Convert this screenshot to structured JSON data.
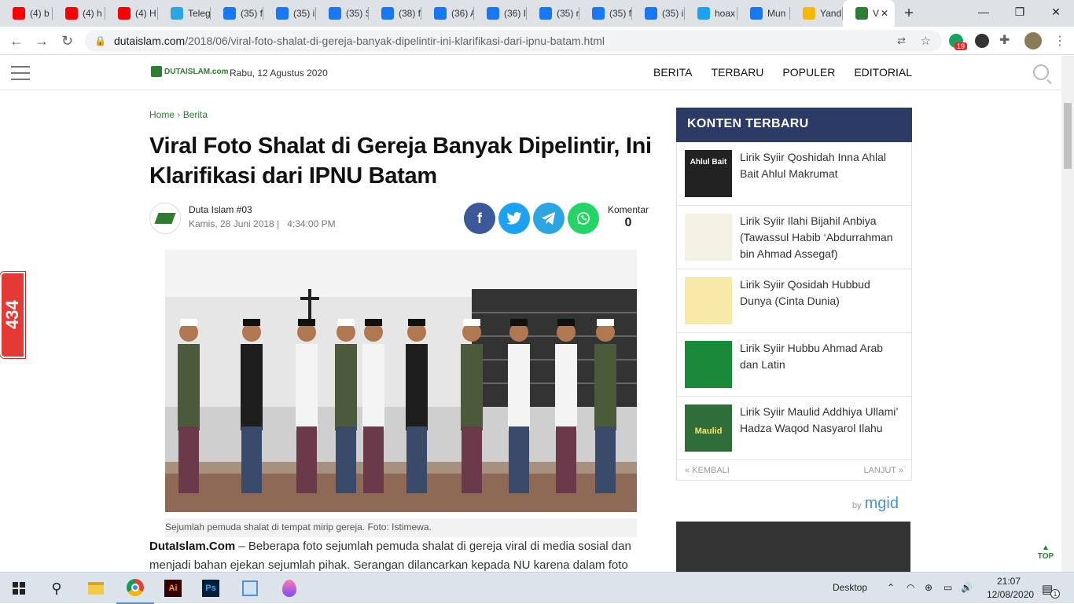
{
  "browser": {
    "tabs": [
      {
        "label": "(4) b",
        "icon": "youtube-icon",
        "color": "#ff0000"
      },
      {
        "label": "(4) h",
        "icon": "youtube-icon",
        "color": "#ff0000"
      },
      {
        "label": "(4) H",
        "icon": "youtube-icon",
        "color": "#ff0000"
      },
      {
        "label": "Teleg",
        "icon": "telegram-icon",
        "color": "#2ca5e0"
      },
      {
        "label": "(35) f",
        "icon": "facebook-icon",
        "color": "#1877f2"
      },
      {
        "label": "(35) i",
        "icon": "facebook-icon",
        "color": "#1877f2"
      },
      {
        "label": "(35) S",
        "icon": "facebook-icon",
        "color": "#1877f2"
      },
      {
        "label": "(38) f",
        "icon": "facebook-icon",
        "color": "#1877f2"
      },
      {
        "label": "(36) A",
        "icon": "facebook-icon",
        "color": "#1877f2"
      },
      {
        "label": "(36) I",
        "icon": "facebook-icon",
        "color": "#1877f2"
      },
      {
        "label": "(35) r",
        "icon": "facebook-icon",
        "color": "#1877f2"
      },
      {
        "label": "(35) f",
        "icon": "facebook-icon",
        "color": "#1877f2"
      },
      {
        "label": "(35) i",
        "icon": "facebook-icon",
        "color": "#1877f2"
      },
      {
        "label": "hoax",
        "icon": "twitter-icon",
        "color": "#1da1f2"
      },
      {
        "label": "Mun",
        "icon": "facebook-icon",
        "color": "#1877f2"
      },
      {
        "label": "Yand",
        "icon": "yandex-icon",
        "color": "#f5b700"
      },
      {
        "label": "V",
        "icon": "dutaislam-icon",
        "color": "#2e7d32",
        "active": true
      }
    ],
    "url_host": "dutaislam.com",
    "url_path": "/2018/06/viral-foto-shalat-di-gereja-banyak-dipelintir-ini-klarifikasi-dari-ipnu-batam.html",
    "ext_badge": "19"
  },
  "site": {
    "logo_text": "DUTAISLAM.com",
    "date": "Rabu, 12 Agustus 2020",
    "menu": [
      "BERITA",
      "TERBARU",
      "POPULER",
      "EDITORIAL"
    ]
  },
  "article": {
    "crumb_home": "Home",
    "crumb_sep": "›",
    "crumb_cat": "Berita",
    "title": "Viral Foto Shalat di Gereja Banyak Dipelintir, Ini Klarifikasi dari IPNU Batam",
    "author": "Duta Islam #03",
    "date": "Kamis, 28 Juni 2018 |",
    "time": "4:34:00 PM",
    "comments_label": "Komentar",
    "comments_count": "0",
    "caption": "Sejumlah pemuda shalat di tempat mirip gereja. Foto: Istimewa.",
    "lead_bold": "DutaIslam.Com",
    "lead_text": " – Beberapa foto sejumlah pemuda shalat di gereja viral di media sosial dan menjadi bahan ejekan sejumlah pihak. Serangan dilancarkan kepada NU karena dalam foto"
  },
  "share": [
    {
      "name": "facebook",
      "glyph": "f",
      "color": "#3b5998"
    },
    {
      "name": "twitter",
      "glyph": "t",
      "color": "#1da1f2"
    },
    {
      "name": "telegram",
      "glyph": "➤",
      "color": "#2ca5e0"
    },
    {
      "name": "whatsapp",
      "glyph": "✆",
      "color": "#25d366"
    }
  ],
  "sidebar": {
    "heading": "KONTEN TERBARU",
    "items": [
      {
        "title": "Lirik Syiir Qoshidah Inna Ahlal Bait Ahlul Makrumat",
        "thumb_text": "Ahlul Bait"
      },
      {
        "title": "Lirik Syiir Ilahi Bijahil Anbiya (Tawassul Habib ‘Abdurrahman bin Ahmad Assegaf)",
        "thumb_text": ""
      },
      {
        "title": "Lirik Syiir Qosidah Hubbud Dunya (Cinta Dunia)",
        "thumb_text": ""
      },
      {
        "title": "Lirik Syiir Hubbu Ahmad Arab dan Latin",
        "thumb_text": ""
      },
      {
        "title": "Lirik Syiir Maulid Addhiya Ullami’ Hadza Waqod Nasyarol Ilahu",
        "thumb_text": "Maulid"
      }
    ],
    "prev": "« KEMBALI",
    "next": "LANJUT »",
    "by": "by",
    "brand": "mgid"
  },
  "float_badge": "434",
  "top_label": "TOP",
  "taskbar": {
    "desktop_label": "Desktop",
    "time": "21:07",
    "date": "12/08/2020",
    "notif": "1"
  }
}
